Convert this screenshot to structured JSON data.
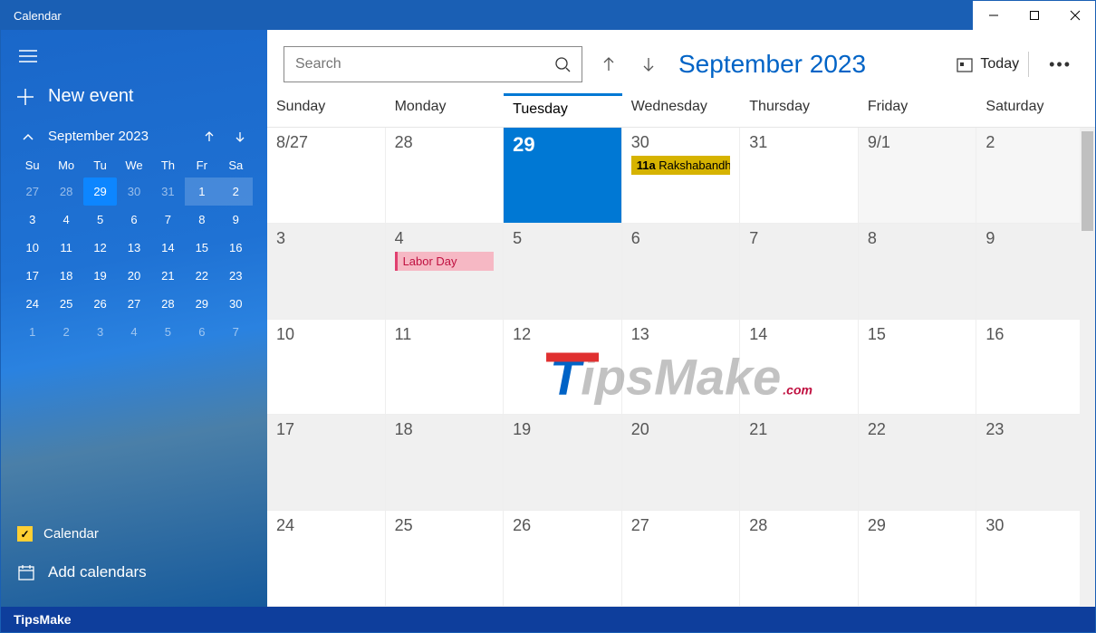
{
  "window": {
    "title": "Calendar"
  },
  "sidebar": {
    "newEvent": "New event",
    "monthLabel": "September 2023",
    "dayAbbrev": [
      "Su",
      "Mo",
      "Tu",
      "We",
      "Th",
      "Fr",
      "Sa"
    ],
    "miniWeeks": [
      [
        {
          "d": "27",
          "dim": true
        },
        {
          "d": "28",
          "dim": true
        },
        {
          "d": "29",
          "sel": true
        },
        {
          "d": "30",
          "dim": true
        },
        {
          "d": "31",
          "dim": true
        },
        {
          "d": "1",
          "cur": true
        },
        {
          "d": "2",
          "cur": true
        }
      ],
      [
        {
          "d": "3"
        },
        {
          "d": "4"
        },
        {
          "d": "5"
        },
        {
          "d": "6"
        },
        {
          "d": "7"
        },
        {
          "d": "8"
        },
        {
          "d": "9"
        }
      ],
      [
        {
          "d": "10"
        },
        {
          "d": "11"
        },
        {
          "d": "12"
        },
        {
          "d": "13"
        },
        {
          "d": "14"
        },
        {
          "d": "15"
        },
        {
          "d": "16"
        }
      ],
      [
        {
          "d": "17"
        },
        {
          "d": "18"
        },
        {
          "d": "19"
        },
        {
          "d": "20"
        },
        {
          "d": "21"
        },
        {
          "d": "22"
        },
        {
          "d": "23"
        }
      ],
      [
        {
          "d": "24"
        },
        {
          "d": "25"
        },
        {
          "d": "26"
        },
        {
          "d": "27"
        },
        {
          "d": "28"
        },
        {
          "d": "29"
        },
        {
          "d": "30"
        }
      ],
      [
        {
          "d": "1",
          "dim": true
        },
        {
          "d": "2",
          "dim": true
        },
        {
          "d": "3",
          "dim": true
        },
        {
          "d": "4",
          "dim": true
        },
        {
          "d": "5",
          "dim": true
        },
        {
          "d": "6",
          "dim": true
        },
        {
          "d": "7",
          "dim": true
        }
      ]
    ],
    "calendarName": "Calendar",
    "addCalendars": "Add calendars"
  },
  "toolbar": {
    "searchPlaceholder": "Search",
    "monthTitle": "September 2023",
    "today": "Today"
  },
  "dayHeaders": [
    "Sunday",
    "Monday",
    "Tuesday",
    "Wednesday",
    "Thursday",
    "Friday",
    "Saturday"
  ],
  "todayColumnIndex": 2,
  "cells": [
    {
      "label": "8/27"
    },
    {
      "label": "28"
    },
    {
      "label": "29",
      "selected": true
    },
    {
      "label": "30",
      "events": [
        {
          "time": "11a",
          "title": "Rakshabandhan",
          "style": "yellow"
        }
      ]
    },
    {
      "label": "31"
    },
    {
      "label": "9/1",
      "alt": true
    },
    {
      "label": "2",
      "alt": true
    },
    {
      "label": "3",
      "dark": true
    },
    {
      "label": "4",
      "dark": true,
      "events": [
        {
          "title": "Labor Day",
          "style": "pink"
        }
      ]
    },
    {
      "label": "5",
      "dark": true
    },
    {
      "label": "6",
      "dark": true
    },
    {
      "label": "7",
      "dark": true
    },
    {
      "label": "8",
      "dark": true
    },
    {
      "label": "9",
      "dark": true
    },
    {
      "label": "10"
    },
    {
      "label": "11"
    },
    {
      "label": "12"
    },
    {
      "label": "13"
    },
    {
      "label": "14"
    },
    {
      "label": "15"
    },
    {
      "label": "16"
    },
    {
      "label": "17",
      "dark": true
    },
    {
      "label": "18",
      "dark": true
    },
    {
      "label": "19",
      "dark": true
    },
    {
      "label": "20",
      "dark": true
    },
    {
      "label": "21",
      "dark": true
    },
    {
      "label": "22",
      "dark": true
    },
    {
      "label": "23",
      "dark": true
    },
    {
      "label": "24"
    },
    {
      "label": "25"
    },
    {
      "label": "26"
    },
    {
      "label": "27"
    },
    {
      "label": "28"
    },
    {
      "label": "29"
    },
    {
      "label": "30"
    }
  ],
  "watermark": {
    "brand": "TipsMake",
    "suffix": ".com"
  },
  "footer": "TipsMake"
}
